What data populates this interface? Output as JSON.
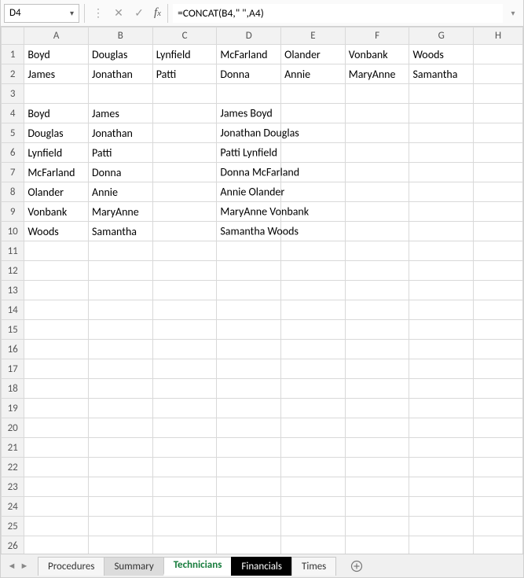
{
  "name_box": "D4",
  "formula": "=CONCAT(B4,\" \",A4)",
  "columns": [
    "A",
    "B",
    "C",
    "D",
    "E",
    "F",
    "G",
    "H"
  ],
  "rows": [
    1,
    2,
    3,
    4,
    5,
    6,
    7,
    8,
    9,
    10,
    11,
    12,
    13,
    14,
    15,
    16,
    17,
    18,
    19,
    20,
    21,
    22,
    23,
    24,
    25,
    26
  ],
  "cells": {
    "1": {
      "A": "Boyd",
      "B": "Douglas",
      "C": "Lynfield",
      "D": "McFarland",
      "E": "Olander",
      "F": "Vonbank",
      "G": "Woods"
    },
    "2": {
      "A": "James",
      "B": "Jonathan",
      "C": "Patti",
      "D": "Donna",
      "E": "Annie",
      "F": "MaryAnne",
      "G": "Samantha"
    },
    "4": {
      "A": "Boyd",
      "B": "James",
      "D": "James Boyd"
    },
    "5": {
      "A": "Douglas",
      "B": "Jonathan",
      "D": "Jonathan Douglas"
    },
    "6": {
      "A": "Lynfield",
      "B": "Patti",
      "D": "Patti Lynfield"
    },
    "7": {
      "A": "McFarland",
      "B": "Donna",
      "D": "Donna McFarland"
    },
    "8": {
      "A": "Olander",
      "B": "Annie",
      "D": "Annie Olander"
    },
    "9": {
      "A": "Vonbank",
      "B": "MaryAnne",
      "D": "MaryAnne Vonbank"
    },
    "10": {
      "A": "Woods",
      "B": "Samantha",
      "D": "Samantha Woods"
    }
  },
  "tabs": {
    "procedures": "Procedures",
    "summary": "Summary",
    "technicians": "Technicians",
    "financials": "Financials",
    "times": "Times"
  }
}
